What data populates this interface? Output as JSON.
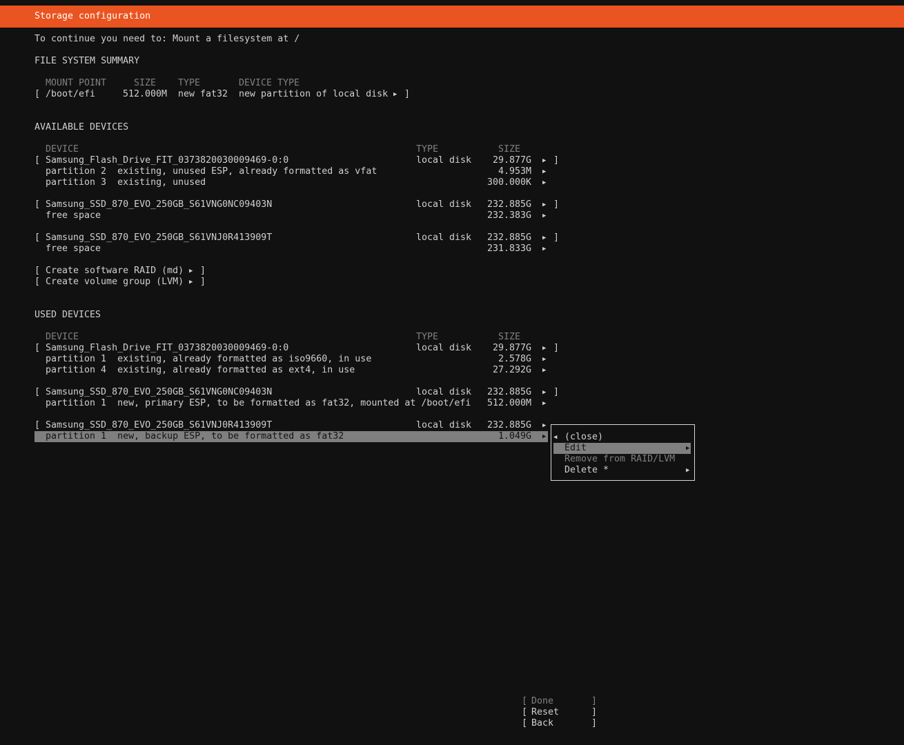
{
  "header": {
    "title": "Storage configuration"
  },
  "notice": "To continue you need to: Mount a filesystem at /",
  "fs_summary": {
    "heading": "FILE SYSTEM SUMMARY",
    "columns": {
      "mount": "MOUNT POINT",
      "size": "SIZE",
      "type": "TYPE",
      "device_type": "DEVICE TYPE"
    },
    "rows": [
      {
        "mount": "/boot/efi",
        "size": "512.000M",
        "type": "new fat32",
        "device_type": "new partition of local disk"
      }
    ]
  },
  "available": {
    "heading": "AVAILABLE DEVICES",
    "columns": {
      "device": "DEVICE",
      "type": "TYPE",
      "size": "SIZE"
    },
    "disk1": {
      "name": "Samsung_Flash_Drive_FIT_0373820030009469-0:0",
      "type": "local disk",
      "size": "29.877G"
    },
    "disk1_parts": [
      {
        "name": "partition 2  existing, unused ESP, already formatted as vfat",
        "size": "4.953M"
      },
      {
        "name": "partition 3  existing, unused",
        "size": "300.000K"
      }
    ],
    "disk2": {
      "name": "Samsung_SSD_870_EVO_250GB_S61VNG0NC09403N",
      "type": "local disk",
      "size": "232.885G"
    },
    "disk2_free": {
      "name": "free space",
      "size": "232.383G"
    },
    "disk3": {
      "name": "Samsung_SSD_870_EVO_250GB_S61VNJ0R413909T",
      "type": "local disk",
      "size": "232.885G"
    },
    "disk3_free": {
      "name": "free space",
      "size": "231.833G"
    },
    "actions": [
      "Create software RAID (md)",
      "Create volume group (LVM)"
    ]
  },
  "used": {
    "heading": "USED DEVICES",
    "columns": {
      "device": "DEVICE",
      "type": "TYPE",
      "size": "SIZE"
    },
    "disk1": {
      "name": "Samsung_Flash_Drive_FIT_0373820030009469-0:0",
      "type": "local disk",
      "size": "29.877G"
    },
    "disk1_parts": [
      {
        "name": "partition 1  existing, already formatted as iso9660, in use",
        "size": "2.578G"
      },
      {
        "name": "partition 4  existing, already formatted as ext4, in use",
        "size": "27.292G"
      }
    ],
    "disk2": {
      "name": "Samsung_SSD_870_EVO_250GB_S61VNG0NC09403N",
      "type": "local disk",
      "size": "232.885G"
    },
    "disk2_parts": [
      {
        "name": "partition 1  new, primary ESP, to be formatted as fat32, mounted at /boot/efi",
        "size": "512.000M"
      }
    ],
    "disk3": {
      "name": "Samsung_SSD_870_EVO_250GB_S61VNJ0R413909T",
      "type": "local disk",
      "size": "232.885G"
    },
    "disk3_parts": [
      {
        "name": "partition 1  new, backup ESP, to be formatted as fat32",
        "size": "1.049G"
      }
    ]
  },
  "context_menu": {
    "close": "(close)",
    "edit": "Edit",
    "remove": "Remove from RAID/LVM",
    "delete": "Delete *"
  },
  "footer_buttons": {
    "done": "Done",
    "reset": "Reset",
    "back": "Back"
  },
  "colors": {
    "accent": "#e95420",
    "background": "#111111",
    "text": "#d0d0d0",
    "selection": "#7f7f7f",
    "disabled": "#808080"
  },
  "icons": {
    "expand": "right-triangle-icon",
    "collapse": "left-triangle-icon"
  }
}
